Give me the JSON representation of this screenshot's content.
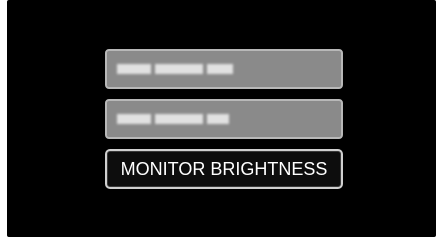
{
  "menu": {
    "items": [
      {
        "label": "",
        "state": "obscured"
      },
      {
        "label": "",
        "state": "obscured"
      },
      {
        "label": "MONITOR BRIGHTNESS",
        "state": "selected"
      }
    ]
  }
}
